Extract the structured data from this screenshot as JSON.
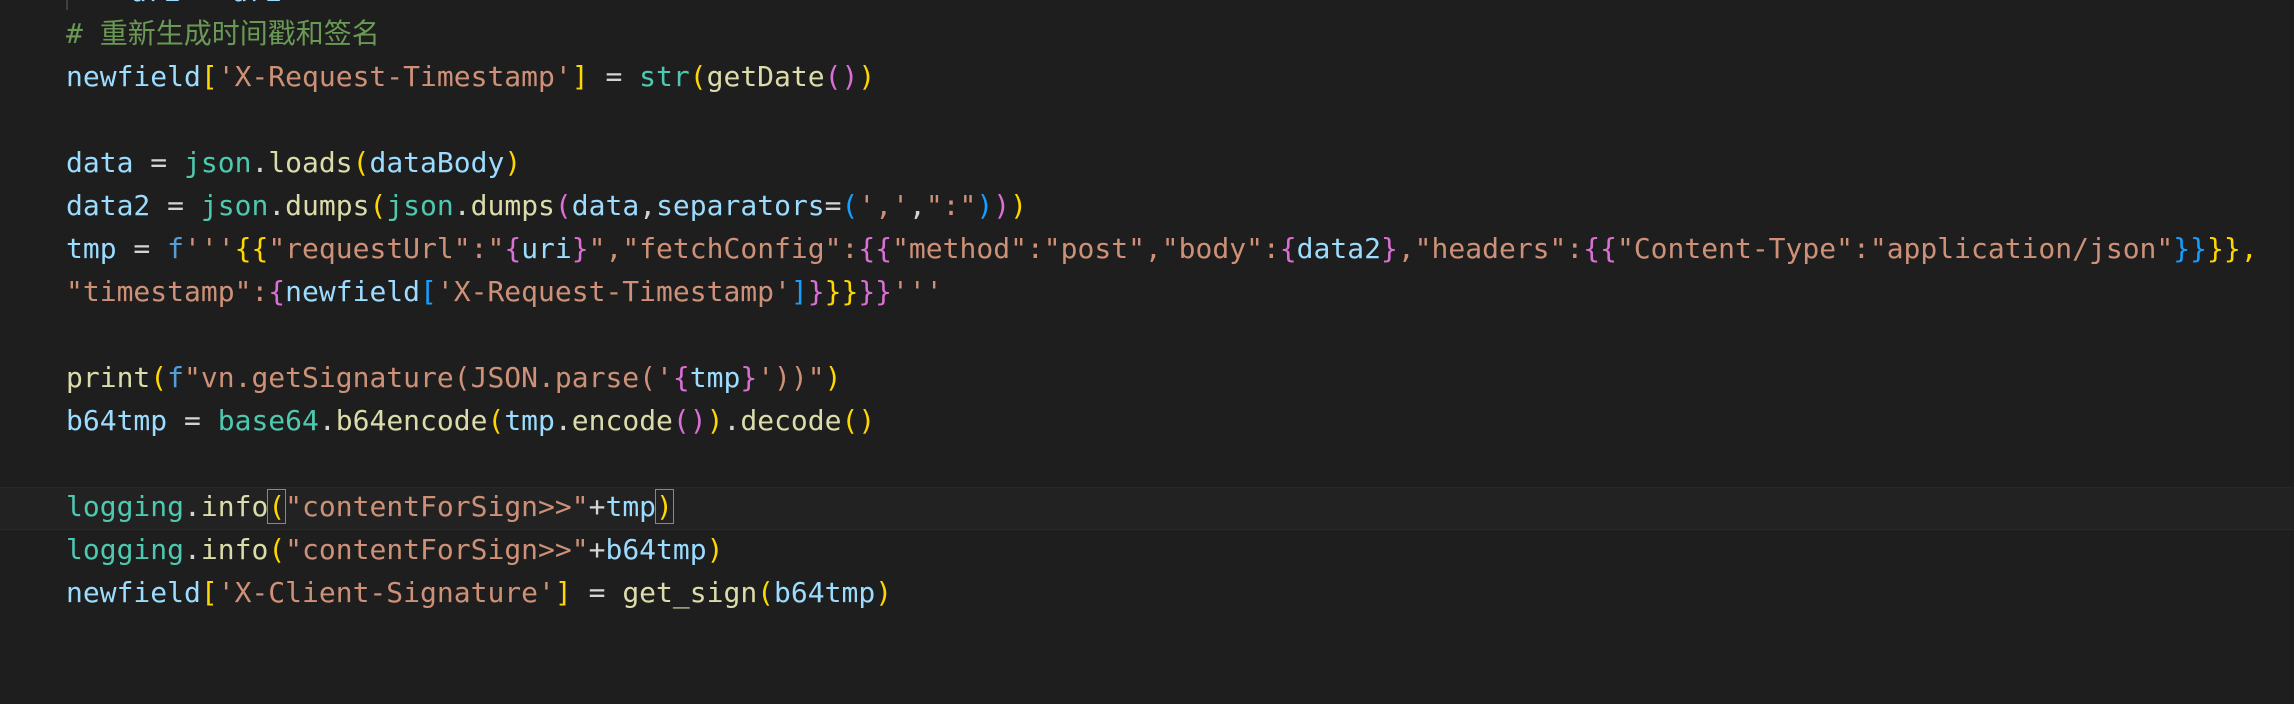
{
  "editor": {
    "language": "python",
    "partial_top_line": "uri = uri",
    "lines": [
      {
        "id": "comment",
        "tokens": [
          {
            "t": "# 重新生成时间戳和签名",
            "c": "comment"
          }
        ]
      },
      {
        "id": "timestamp-assign",
        "tokens": [
          {
            "t": "newfield",
            "c": "var"
          },
          {
            "t": "[",
            "c": "b1"
          },
          {
            "t": "'X-Request-Timestamp'",
            "c": "str"
          },
          {
            "t": "]",
            "c": "b1"
          },
          {
            "t": " = ",
            "c": "op"
          },
          {
            "t": "str",
            "c": "cls"
          },
          {
            "t": "(",
            "c": "b1"
          },
          {
            "t": "getDate",
            "c": "fn"
          },
          {
            "t": "()",
            "c": "b2"
          },
          {
            "t": ")",
            "c": "b1"
          }
        ]
      },
      {
        "id": "blank-1",
        "tokens": []
      },
      {
        "id": "data-loads",
        "tokens": [
          {
            "t": "data",
            "c": "var"
          },
          {
            "t": " = ",
            "c": "op"
          },
          {
            "t": "json",
            "c": "cls"
          },
          {
            "t": ".",
            "c": "op"
          },
          {
            "t": "loads",
            "c": "fn"
          },
          {
            "t": "(",
            "c": "b1"
          },
          {
            "t": "dataBody",
            "c": "var"
          },
          {
            "t": ")",
            "c": "b1"
          }
        ]
      },
      {
        "id": "data2-dumps",
        "tokens": [
          {
            "t": "data2",
            "c": "var"
          },
          {
            "t": " = ",
            "c": "op"
          },
          {
            "t": "json",
            "c": "cls"
          },
          {
            "t": ".",
            "c": "op"
          },
          {
            "t": "dumps",
            "c": "fn"
          },
          {
            "t": "(",
            "c": "b1"
          },
          {
            "t": "json",
            "c": "cls"
          },
          {
            "t": ".",
            "c": "op"
          },
          {
            "t": "dumps",
            "c": "fn"
          },
          {
            "t": "(",
            "c": "b2"
          },
          {
            "t": "data",
            "c": "var"
          },
          {
            "t": ",",
            "c": "op"
          },
          {
            "t": "separators",
            "c": "var"
          },
          {
            "t": "=",
            "c": "op"
          },
          {
            "t": "(",
            "c": "b3"
          },
          {
            "t": "','",
            "c": "str"
          },
          {
            "t": ",",
            "c": "op"
          },
          {
            "t": "\":\"",
            "c": "str"
          },
          {
            "t": ")",
            "c": "b3"
          },
          {
            "t": ")",
            "c": "b2"
          },
          {
            "t": ")",
            "c": "b1"
          }
        ]
      },
      {
        "id": "tmp-fstring",
        "tokens": [
          {
            "t": "tmp",
            "c": "var"
          },
          {
            "t": " = ",
            "c": "op"
          },
          {
            "t": "f",
            "c": "kw"
          },
          {
            "t": "'''",
            "c": "str"
          },
          {
            "t": "{{",
            "c": "b1"
          },
          {
            "t": "\"requestUrl\":\"",
            "c": "str"
          },
          {
            "t": "{",
            "c": "b2"
          },
          {
            "t": "uri",
            "c": "var"
          },
          {
            "t": "}",
            "c": "b2"
          },
          {
            "t": "\",\"fetchConfig\":",
            "c": "str"
          },
          {
            "t": "{{",
            "c": "b2"
          },
          {
            "t": "\"method\":\"post\",\"body\":",
            "c": "str"
          },
          {
            "t": "{",
            "c": "b2"
          },
          {
            "t": "data2",
            "c": "var"
          },
          {
            "t": "}",
            "c": "b2"
          },
          {
            "t": ",\"headers\":",
            "c": "str"
          },
          {
            "t": "{{",
            "c": "b2"
          },
          {
            "t": "\"Content-Type\":\"application/json\"",
            "c": "str"
          },
          {
            "t": "}}",
            "c": "b3"
          },
          {
            "t": "}},",
            "c": "b1"
          }
        ]
      },
      {
        "id": "tmp-fstring-cont",
        "tokens": [
          {
            "t": "\"timestamp\":",
            "c": "str"
          },
          {
            "t": "{",
            "c": "b2"
          },
          {
            "t": "newfield",
            "c": "var"
          },
          {
            "t": "[",
            "c": "b3"
          },
          {
            "t": "'X-Request-Timestamp'",
            "c": "str"
          },
          {
            "t": "]",
            "c": "b3"
          },
          {
            "t": "}",
            "c": "b2"
          },
          {
            "t": "}}",
            "c": "b1"
          },
          {
            "t": "}}",
            "c": "b2"
          },
          {
            "t": "'''",
            "c": "str"
          }
        ]
      },
      {
        "id": "blank-2",
        "tokens": []
      },
      {
        "id": "print-signature",
        "tokens": [
          {
            "t": "print",
            "c": "fn"
          },
          {
            "t": "(",
            "c": "b1"
          },
          {
            "t": "f",
            "c": "kw"
          },
          {
            "t": "\"vn.getSignature(JSON.parse('",
            "c": "str"
          },
          {
            "t": "{",
            "c": "b2"
          },
          {
            "t": "tmp",
            "c": "var"
          },
          {
            "t": "}",
            "c": "b2"
          },
          {
            "t": "'))\"",
            "c": "str"
          },
          {
            "t": ")",
            "c": "b1"
          }
        ]
      },
      {
        "id": "b64-encode",
        "tokens": [
          {
            "t": "b64tmp",
            "c": "var"
          },
          {
            "t": " = ",
            "c": "op"
          },
          {
            "t": "base64",
            "c": "cls"
          },
          {
            "t": ".",
            "c": "op"
          },
          {
            "t": "b64encode",
            "c": "fn"
          },
          {
            "t": "(",
            "c": "b1"
          },
          {
            "t": "tmp",
            "c": "var"
          },
          {
            "t": ".",
            "c": "op"
          },
          {
            "t": "encode",
            "c": "fn"
          },
          {
            "t": "()",
            "c": "b2"
          },
          {
            "t": ")",
            "c": "b1"
          },
          {
            "t": ".",
            "c": "op"
          },
          {
            "t": "decode",
            "c": "fn"
          },
          {
            "t": "()",
            "c": "b1"
          }
        ]
      },
      {
        "id": "blank-3",
        "tokens": []
      },
      {
        "id": "log-tmp",
        "tokens": [
          {
            "t": "logging",
            "c": "cls"
          },
          {
            "t": ".",
            "c": "op"
          },
          {
            "t": "info",
            "c": "fn"
          },
          {
            "t": "(",
            "c": "b1 cursor-bracket"
          },
          {
            "t": "\"contentForSign>>\"",
            "c": "str"
          },
          {
            "t": "+",
            "c": "op"
          },
          {
            "t": "tmp",
            "c": "var"
          },
          {
            "t": ")",
            "c": "b1 cursor-bracket"
          }
        ]
      },
      {
        "id": "log-b64",
        "tokens": [
          {
            "t": "logging",
            "c": "cls"
          },
          {
            "t": ".",
            "c": "op"
          },
          {
            "t": "info",
            "c": "fn"
          },
          {
            "t": "(",
            "c": "b1"
          },
          {
            "t": "\"contentForSign>>\"",
            "c": "str"
          },
          {
            "t": "+",
            "c": "op"
          },
          {
            "t": "b64tmp",
            "c": "var"
          },
          {
            "t": ")",
            "c": "b1"
          }
        ]
      },
      {
        "id": "signature-assign",
        "tokens": [
          {
            "t": "newfield",
            "c": "var"
          },
          {
            "t": "[",
            "c": "b1"
          },
          {
            "t": "'X-Client-Signature'",
            "c": "str"
          },
          {
            "t": "]",
            "c": "b1"
          },
          {
            "t": " = ",
            "c": "op"
          },
          {
            "t": "get_sign",
            "c": "fn"
          },
          {
            "t": "(",
            "c": "b1"
          },
          {
            "t": "b64tmp",
            "c": "var"
          },
          {
            "t": ")",
            "c": "b1"
          }
        ]
      }
    ]
  }
}
